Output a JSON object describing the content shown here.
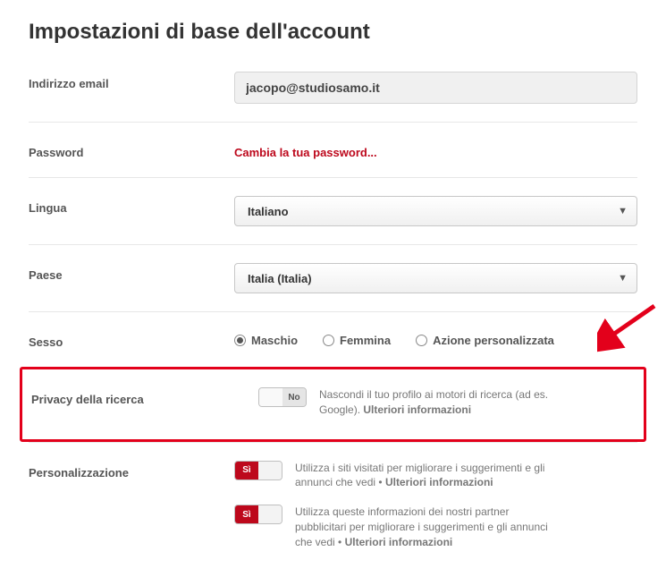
{
  "page": {
    "title": "Impostazioni di base dell'account"
  },
  "email": {
    "label": "Indirizzo email",
    "value": "jacopo@studiosamo.it"
  },
  "password": {
    "label": "Password",
    "change_link": "Cambia la tua password..."
  },
  "language": {
    "label": "Lingua",
    "selected": "Italiano"
  },
  "country": {
    "label": "Paese",
    "selected": "Italia (Italia)"
  },
  "gender": {
    "label": "Sesso",
    "options": {
      "m": "Maschio",
      "f": "Femmina",
      "c": "Azione personalizzata"
    },
    "selected": "m"
  },
  "privacy": {
    "label": "Privacy della ricerca",
    "toggle_state": "No",
    "desc": "Nascondi il tuo profilo ai motori di ricerca (ad es. Google). ",
    "more": "Ulteriori informazioni"
  },
  "personalization": {
    "label": "Personalizzazione",
    "items": [
      {
        "state": "Sì",
        "desc": "Utilizza i siti visitati per migliorare i suggerimenti e gli annunci che vedi • ",
        "more": "Ulteriori informazioni"
      },
      {
        "state": "Sì",
        "desc": "Utilizza queste informazioni dei nostri partner pubblicitari per migliorare i suggerimenti e gli annunci che vedi • ",
        "more": "Ulteriori informazioni"
      }
    ]
  }
}
